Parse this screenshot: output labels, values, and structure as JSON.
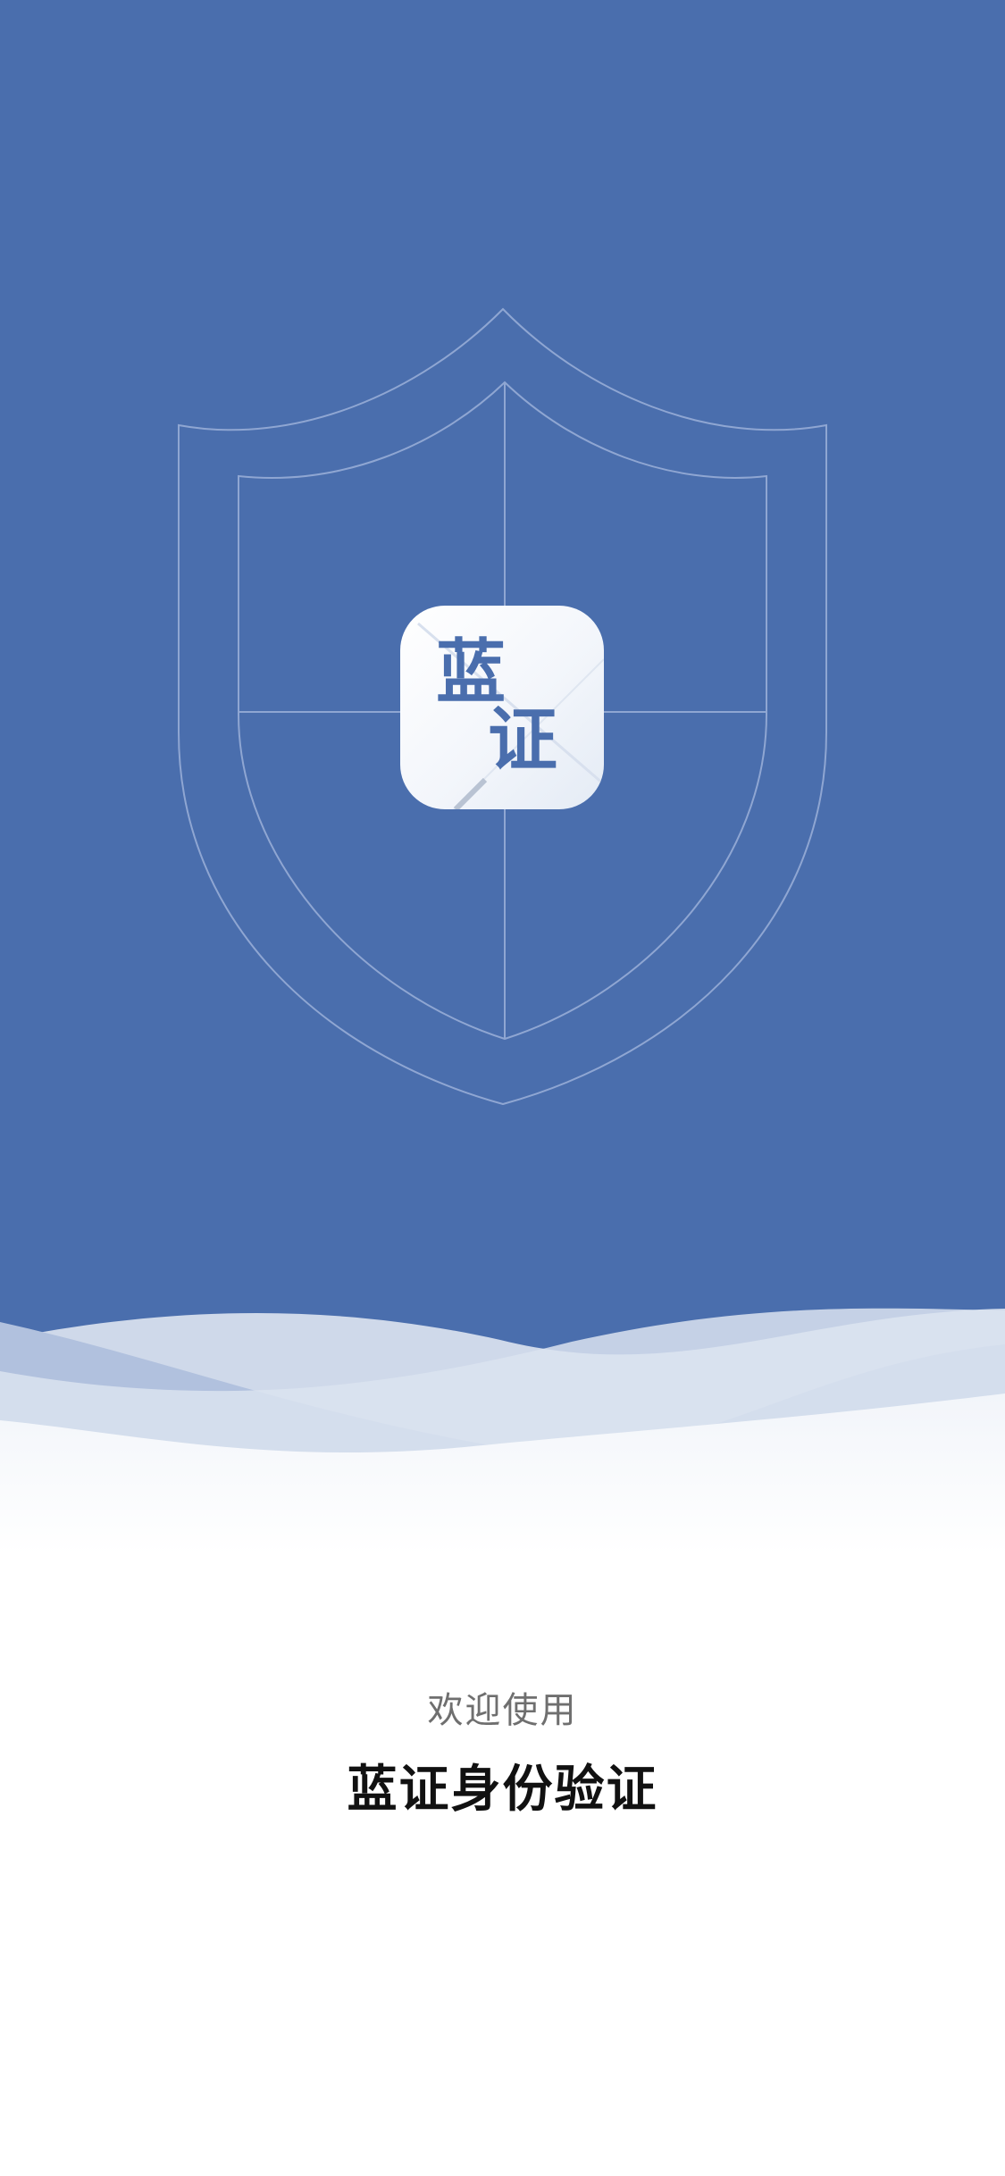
{
  "app_icon": {
    "char_1": "蓝",
    "char_2": "证"
  },
  "welcome_text": "欢迎使用",
  "title": "蓝证身份验证",
  "colors": {
    "brand_blue": "#4a6ead",
    "welcome_gray": "#6f6f6f",
    "title_black": "#111111"
  },
  "icons": [
    "shield-icon",
    "app-logo-icon",
    "wave-decoration"
  ]
}
